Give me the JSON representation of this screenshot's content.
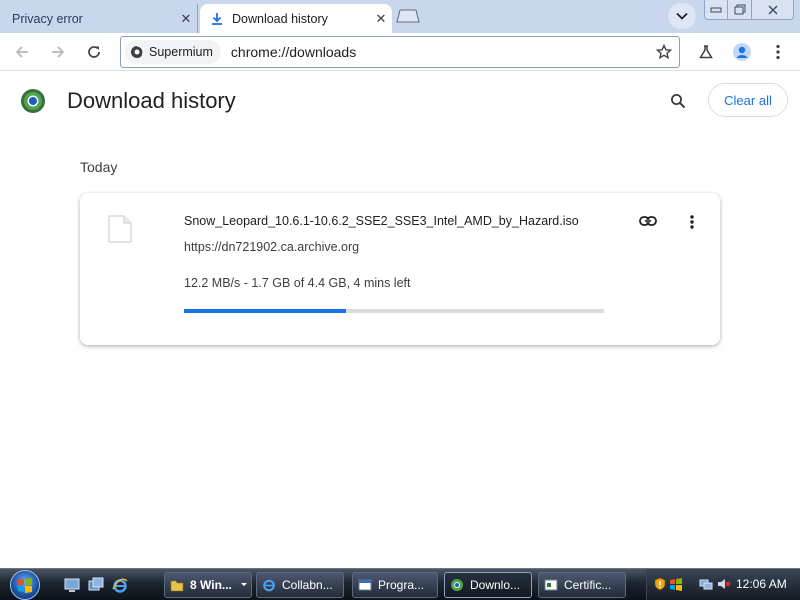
{
  "browser": {
    "tabs": [
      {
        "title": "Privacy error",
        "close": "✕"
      },
      {
        "title": "Download history",
        "close": "✕"
      }
    ],
    "chip_label": "Supermium",
    "url": "chrome://downloads"
  },
  "page": {
    "title": "Download history",
    "clear_all_label": "Clear all",
    "date_group": "Today"
  },
  "download": {
    "file_name": "Snow_Leopard_10.6.1-10.6.2_SSE2_SSE3_Intel_AMD_by_Hazard.iso",
    "source_url": "https://dn721902.ca.archive.org",
    "status": "12.2 MB/s - 1.7 GB of 4.4 GB, 4 mins left",
    "progress_percent": 38.6
  },
  "taskbar": {
    "items": [
      {
        "label": "8 Win..."
      },
      {
        "label": "Collabn..."
      },
      {
        "label": "Progra..."
      },
      {
        "label": "Downlo..."
      },
      {
        "label": "Certific..."
      }
    ],
    "clock": "12:06 AM"
  },
  "colors": {
    "accent": "#1a73e8",
    "tabstrip": "#c9d7ee",
    "taskbar": "#1d2530"
  },
  "icons": [
    "download-icon",
    "new-tab-icon",
    "tab-search-icon",
    "back-icon",
    "forward-icon",
    "reload-icon",
    "site-info-icon",
    "star-icon",
    "labs-icon",
    "profile-icon",
    "menu-icon",
    "logo-icon",
    "search-icon",
    "file-icon",
    "copy-link-icon",
    "more-icon",
    "start-orb-icon"
  ]
}
